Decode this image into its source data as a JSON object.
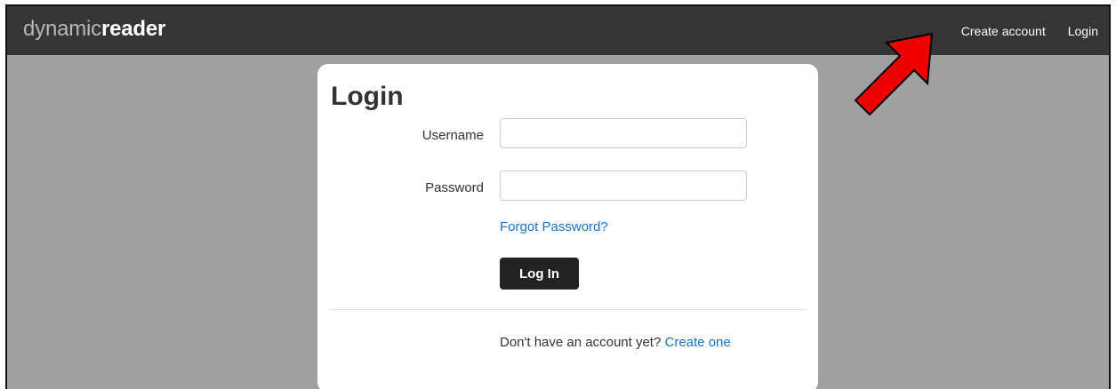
{
  "navbar": {
    "brand_light": "dynamic",
    "brand_bold": "reader",
    "create_account": "Create account",
    "login": "Login"
  },
  "login_form": {
    "title": "Login",
    "username_label": "Username",
    "username_value": "",
    "password_label": "Password",
    "password_value": "",
    "forgot_password": "Forgot Password?",
    "submit_label": "Log In",
    "signup_prompt": "Don't have an account yet?",
    "signup_link": "Create one"
  },
  "colors": {
    "navbar_bg": "#353535",
    "page_bg": "#a0a0a0",
    "link": "#1a73c7",
    "button_bg": "#222222",
    "arrow": "#ee0000"
  },
  "annotation": {
    "icon": "red-arrow-icon",
    "points_to": "Create account"
  }
}
